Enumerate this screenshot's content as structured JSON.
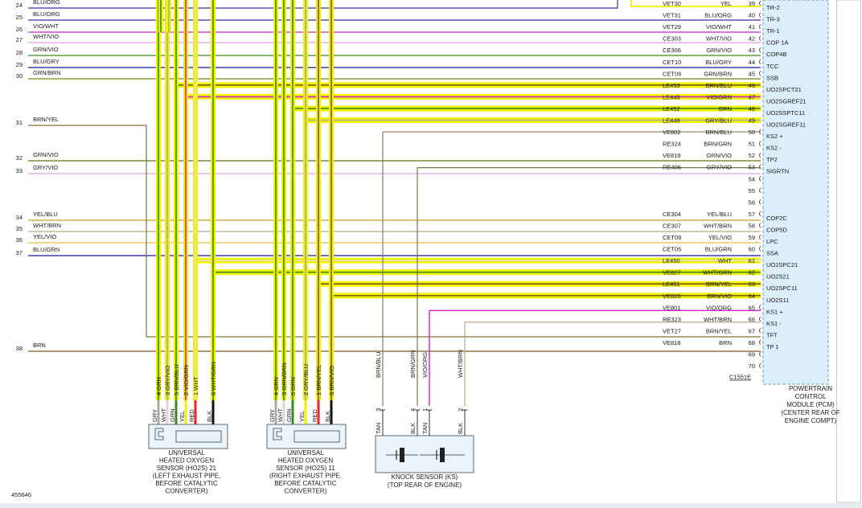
{
  "diagram_id": "455646",
  "pcm": {
    "title_lines": [
      "POWERTRAIN",
      "CONTROL",
      "MODULE (PCM)",
      "(CENTER REAR OF",
      "ENGINE COMPT)"
    ],
    "connector": "C1551E",
    "pins": [
      {
        "num": "39",
        "circuit": "VET30",
        "color": "YEL",
        "label": "TR-2"
      },
      {
        "num": "40",
        "circuit": "VET31",
        "color": "BLU/ORG",
        "label": "TR-3"
      },
      {
        "num": "41",
        "circuit": "VET29",
        "color": "VIO/WHT",
        "label": "TR-1"
      },
      {
        "num": "42",
        "circuit": "CE303",
        "color": "WHT/VIO",
        "label": "COP 1A"
      },
      {
        "num": "43",
        "circuit": "CE306",
        "color": "GRN/VIO",
        "label": "COP4B"
      },
      {
        "num": "44",
        "circuit": "CET10",
        "color": "BLU/GRY",
        "label": "TCC"
      },
      {
        "num": "45",
        "circuit": "CET06",
        "color": "GRN/BRN",
        "label": "SSB"
      },
      {
        "num": "46",
        "circuit": "LE453",
        "color": "BRN/BLU",
        "label": "UO2SPCT21"
      },
      {
        "num": "47",
        "circuit": "LE449",
        "color": "VIO/GRN",
        "label": "UO2SGREF21"
      },
      {
        "num": "48",
        "circuit": "LE452",
        "color": "GRN",
        "label": "UO2SSPTC11"
      },
      {
        "num": "49",
        "circuit": "LE448",
        "color": "GRY/BLU",
        "label": "UO2SGREF11"
      },
      {
        "num": "50",
        "circuit": "VE802",
        "color": "BRN/BLU",
        "label": "KS2 +"
      },
      {
        "num": "51",
        "circuit": "RE324",
        "color": "BRN/GRN",
        "label": "KS2 -"
      },
      {
        "num": "52",
        "circuit": "VE819",
        "color": "GRN/VIO",
        "label": "TP2"
      },
      {
        "num": "53",
        "circuit": "RE406",
        "color": "GRY/VIO",
        "label": "SIGRTN"
      },
      {
        "num": "54",
        "circuit": "",
        "color": "",
        "label": ""
      },
      {
        "num": "55",
        "circuit": "",
        "color": "",
        "label": ""
      },
      {
        "num": "56",
        "circuit": "",
        "color": "",
        "label": ""
      },
      {
        "num": "57",
        "circuit": "CE304",
        "color": "YEL/BLU",
        "label": "COP2C"
      },
      {
        "num": "58",
        "circuit": "CE307",
        "color": "WHT/BRN",
        "label": "COP5D"
      },
      {
        "num": "59",
        "circuit": "CET09",
        "color": "YEL/VIO",
        "label": "LPC"
      },
      {
        "num": "60",
        "circuit": "CET05",
        "color": "BLU/GRN",
        "label": "SSA"
      },
      {
        "num": "61",
        "circuit": "LE450",
        "color": "WHT",
        "label": "UO2SPC21"
      },
      {
        "num": "62",
        "circuit": "VE827",
        "color": "WHT/GRN",
        "label": "UO2S21"
      },
      {
        "num": "63",
        "circuit": "LE451",
        "color": "BRN/YEL",
        "label": "UO2SPC11"
      },
      {
        "num": "64",
        "circuit": "VE826",
        "color": "BRN/VIO",
        "label": "UO2S11"
      },
      {
        "num": "65",
        "circuit": "VE801",
        "color": "VIO/ORG",
        "label": "KS1 +"
      },
      {
        "num": "66",
        "circuit": "RE323",
        "color": "WHT/BRN",
        "label": "KS1 -"
      },
      {
        "num": "67",
        "circuit": "VET27",
        "color": "BRN/YEL",
        "label": "TFT"
      },
      {
        "num": "68",
        "circuit": "VE818",
        "color": "BRN",
        "label": "TP 1"
      },
      {
        "num": "69",
        "circuit": "",
        "color": "",
        "label": ""
      },
      {
        "num": "70",
        "circuit": "",
        "color": "",
        "label": ""
      }
    ]
  },
  "left_wires": [
    {
      "num": "24",
      "color": "BLU/ORG"
    },
    {
      "num": "25",
      "color": "BLU/ORG"
    },
    {
      "num": "26",
      "color": "VIO/WHT"
    },
    {
      "num": "27",
      "color": "WHT/VIO"
    },
    {
      "num": "28",
      "color": "GRN/VIO"
    },
    {
      "num": "29",
      "color": "BLU/GRY"
    },
    {
      "num": "30",
      "color": "GRN/BRN"
    },
    {
      "num": "31",
      "color": "BRN/YEL"
    },
    {
      "num": "32",
      "color": "GRN/VIO"
    },
    {
      "num": "33",
      "color": "GRY/VIO"
    },
    {
      "num": "34",
      "color": "YEL/BLU"
    },
    {
      "num": "35",
      "color": "WHT/BRN"
    },
    {
      "num": "36",
      "color": "YEL/VIO"
    },
    {
      "num": "37",
      "color": "BLU/GRN"
    },
    {
      "num": "38",
      "color": "BRN"
    }
  ],
  "sensor21": {
    "pins": [
      {
        "pin": "4",
        "color": "GRN"
      },
      {
        "pin": "3",
        "color": "GRY/VIO"
      },
      {
        "pin": "5",
        "color": "BRN/BLU"
      },
      {
        "pin": "2",
        "color": "VIO/GRN"
      },
      {
        "pin": "1",
        "color": "WHT"
      },
      {
        "pin": "6",
        "color": "WHT/GRN"
      }
    ],
    "leads": [
      "GRY",
      "WHT",
      "GRN",
      "YEL",
      "RED",
      "BLK"
    ],
    "title_lines": [
      "UNIVERSAL",
      "HEATED OXYGEN",
      "SENSOR (HO2S) 21",
      "(LEFT EXHAUST PIPE,",
      "BEFORE CATALYTIC",
      "CONVERTER)"
    ]
  },
  "sensor11": {
    "pins": [
      {
        "pin": "4",
        "color": "GRN"
      },
      {
        "pin": "3",
        "color": "GRN/BRN"
      },
      {
        "pin": "5",
        "color": "GRN"
      },
      {
        "pin": "2",
        "color": "GRY/BLU"
      },
      {
        "pin": "1",
        "color": "BRN/YEL"
      },
      {
        "pin": "6",
        "color": "BRN/VIO"
      }
    ],
    "leads": [
      "GRY",
      "WHT",
      "GRN",
      "YEL",
      "RED",
      "BLK"
    ],
    "title_lines": [
      "UNIVERSAL",
      "HEATED OXYGEN",
      "SENSOR (HO2S) 11",
      "(RIGHT EXHAUST PIPE,",
      "BEFORE CATALYTIC",
      "CONVERTER)"
    ]
  },
  "knock": {
    "wires": [
      {
        "pin": "3",
        "color": "BRN/BLU",
        "lead": "TAN"
      },
      {
        "pin": "4",
        "color": "BRN/GRN",
        "lead": "BLK"
      },
      {
        "pin": "1",
        "color": "VIO/ORG",
        "lead": "TAN"
      },
      {
        "pin": "2",
        "color": "WHT/BRN",
        "lead": "BLK"
      }
    ],
    "title_lines": [
      "KNOCK SENSOR (KS)",
      "(TOP REAR OF ENGINE)"
    ]
  },
  "colors": {
    "yellow": "#f2f200",
    "green": "#3a8a1f",
    "brown": "#7a5a1e",
    "blue": "#1a1a9a",
    "violet": "#cc22cc",
    "pink": "#e0a0e0",
    "grey": "#a8a8a8",
    "lightblue": "#dceefa",
    "red": "#ee2222",
    "black": "#111111"
  }
}
